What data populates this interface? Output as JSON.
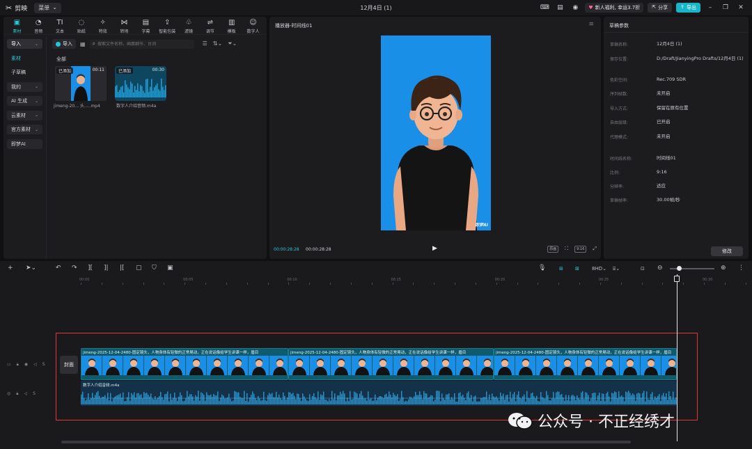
{
  "titlebar": {
    "app_name": "剪映",
    "menu_label": "菜单",
    "window_title": "12月4日 (1)",
    "promo": "新人福利, 幸运3.7折",
    "share": "分享",
    "export": "导出"
  },
  "media": {
    "tabs": [
      {
        "label": "素材",
        "icon": "media-icon",
        "glyph": "▣"
      },
      {
        "label": "音频",
        "icon": "audio-icon",
        "glyph": "◔"
      },
      {
        "label": "文本",
        "icon": "text-icon",
        "glyph": "TI"
      },
      {
        "label": "贴纸",
        "icon": "sticker-icon",
        "glyph": "◌"
      },
      {
        "label": "特效",
        "icon": "effects-icon",
        "glyph": "✧"
      },
      {
        "label": "转场",
        "icon": "transition-icon",
        "glyph": "⋈"
      },
      {
        "label": "字幕",
        "icon": "caption-icon",
        "glyph": "▤"
      },
      {
        "label": "智能包装",
        "icon": "smart-pack-icon",
        "glyph": "⇪"
      },
      {
        "label": "滤镜",
        "icon": "filter-icon",
        "glyph": "♧"
      },
      {
        "label": "调节",
        "icon": "adjust-icon",
        "glyph": "⇌"
      },
      {
        "label": "模板",
        "icon": "template-icon",
        "glyph": "▥"
      },
      {
        "label": "数字人",
        "icon": "digital-human-icon",
        "glyph": "☺"
      }
    ],
    "nav": [
      {
        "label": "导入",
        "chevron": true,
        "style": "selected"
      },
      {
        "label": "素材",
        "chevron": false,
        "style": "active-text"
      },
      {
        "label": "子草稿",
        "chevron": false,
        "style": "plain"
      },
      {
        "label": "我的",
        "chevron": true,
        "style": "normal"
      },
      {
        "label": "AI 生成",
        "chevron": true,
        "style": "normal"
      },
      {
        "label": "云素材",
        "chevron": true,
        "style": "normal"
      },
      {
        "label": "官方素材",
        "chevron": true,
        "style": "normal"
      },
      {
        "label": "即梦AI",
        "chevron": false,
        "style": "normal"
      }
    ],
    "import_label": "导入",
    "search_placeholder": "搜索文件名称、画面细节、台词",
    "all_label": "全部",
    "items": [
      {
        "badge": "已添加",
        "duration": "00:11",
        "name": "jimeng-20... 头.....mp4"
      },
      {
        "badge": "已添加",
        "duration": "00:30",
        "name": "数字人介绍音频.m4a"
      }
    ]
  },
  "player": {
    "title": "播放器-时间线01",
    "current_time": "00:00:28:28",
    "total_time": "00:00:28:28",
    "video_watermark": "即梦AI",
    "tools": [
      "原画",
      "⛶",
      "9:16",
      "⤢"
    ]
  },
  "props": {
    "title": "草稿参数",
    "rows": [
      {
        "label": "草稿名称:",
        "value": "12月4日 (1)"
      },
      {
        "label": "保存位置:",
        "value": "D:/Draft/JianyingPro Drafts/12月4日 (1)"
      },
      {
        "label": "色彩空间:",
        "value": "Rec.709 SDR"
      },
      {
        "label": "序列帧数:",
        "value": "未开启"
      },
      {
        "label": "导入方式:",
        "value": "保留在原有位置"
      },
      {
        "label": "自由层级:",
        "value": "已开启"
      },
      {
        "label": "代理模式:",
        "value": "未开启"
      },
      {
        "label": "时间线名称:",
        "value": "时间线01"
      },
      {
        "label": "比例:",
        "value": "9:16"
      },
      {
        "label": "分辨率:",
        "value": "适应"
      },
      {
        "label": "草稿帧率:",
        "value": "30.00帧/秒"
      }
    ],
    "modify": "修改"
  },
  "timeline": {
    "ruler": [
      "00:00",
      "00:05",
      "00:10",
      "00:15",
      "00:20",
      "00:25",
      "00:30"
    ],
    "cover": "封面",
    "video_clip_title": "jimeng-2025-12-04-2480-固定镜头，人物身体有轻微的正常晃动，正在说话像给学生讲课一样，眉目",
    "audio_clip_title": "数字人介绍音频.m4a",
    "zoom_level": 0.2
  },
  "watermark": "公众号 · 不正经绣才",
  "colors": {
    "accent": "#16b7c9",
    "video_bg": "#1a8fe8",
    "highlight": "#e0393a"
  }
}
